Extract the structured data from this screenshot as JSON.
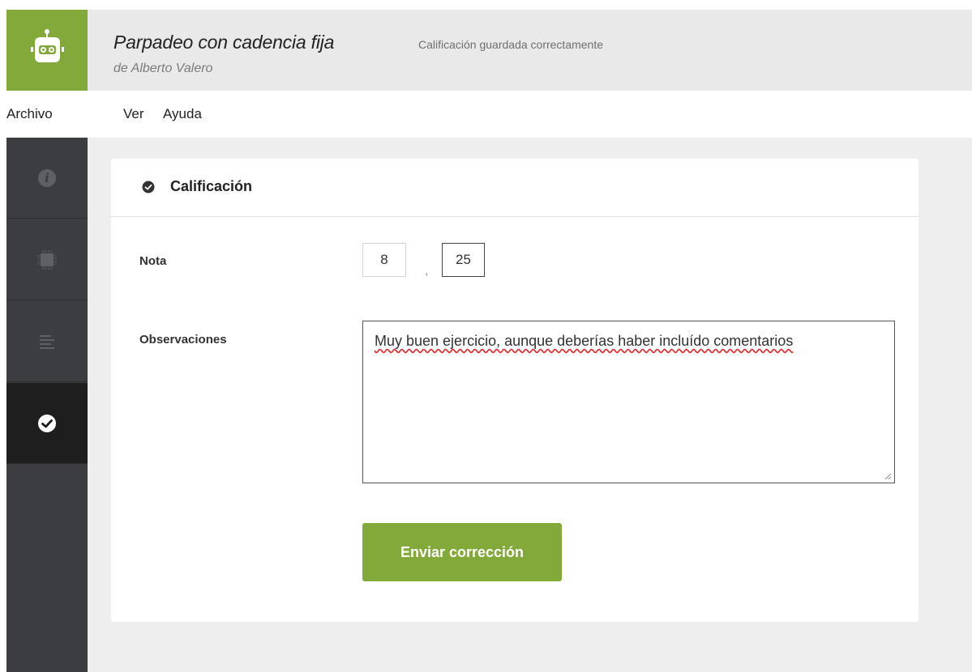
{
  "header": {
    "title": "Parpadeo con cadencia fija",
    "author": "de Alberto Valero",
    "status": "Calificación guardada correctamente",
    "logo_icon": "robot-icon",
    "accent_color": "#82a93a"
  },
  "menu": {
    "items": [
      "Archivo",
      "Ver",
      "Ayuda"
    ]
  },
  "sidebar": {
    "items": [
      {
        "icon": "info-icon"
      },
      {
        "icon": "chip-icon"
      },
      {
        "icon": "lines-icon"
      },
      {
        "icon": "check-circle-icon",
        "active": true
      }
    ]
  },
  "card": {
    "title": "Calificación",
    "nota_label": "Nota",
    "nota_integer": "8",
    "nota_separator": ",",
    "nota_decimal": "25",
    "observaciones_label": "Observaciones",
    "observaciones_value": "Muy buen ejercicio, aunque deberías haber incluído comentarios",
    "submit_label": "Enviar corrección"
  }
}
